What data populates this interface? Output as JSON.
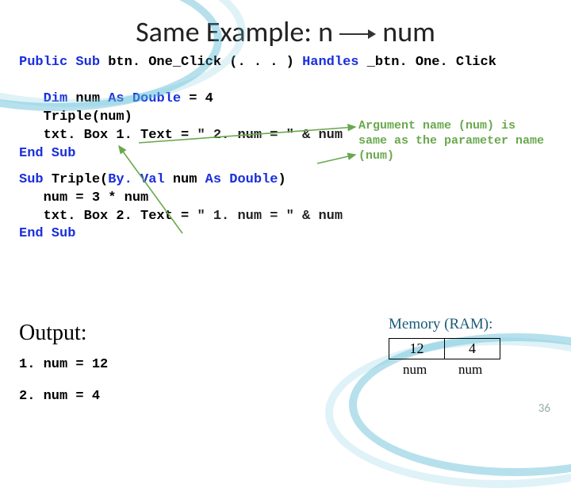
{
  "title": {
    "pre": "Same Example: n",
    "post": "num"
  },
  "code": {
    "l1a": "Public Sub ",
    "l1b": "btn. One_Click (. . . ) ",
    "l1c": "Handles ",
    "l1d": "_btn. One. Click",
    "l2a": "   Dim ",
    "l2b": "num ",
    "l2c": "As Double ",
    "l2d": "= 4",
    "l3": "   Triple(num)",
    "l4a": "   txt. Box 1. Text = ",
    "l4b": "\" 2. num = \" & num",
    "l5": "End Sub",
    "l6a": "Sub ",
    "l6b": "Triple(",
    "l6c": "By. Val ",
    "l6d": "num ",
    "l6e": "As Double",
    "l6f": ")",
    "l7": "   num = 3 * num",
    "l8a": "   txt. Box 2. Text = ",
    "l8b": "\" 1. num = \" & num",
    "l9": "End Sub"
  },
  "note": {
    "l1": "Argument name (num) is",
    "l2": "same as the parameter name",
    "l3": "(num)"
  },
  "output": {
    "heading": "Output:",
    "l1": "1. num = 12",
    "l2": "2. num = 4"
  },
  "memory": {
    "title": "Memory (RAM):",
    "c1": "12",
    "c2": "4",
    "lbl": "num"
  },
  "slide_no": "36"
}
